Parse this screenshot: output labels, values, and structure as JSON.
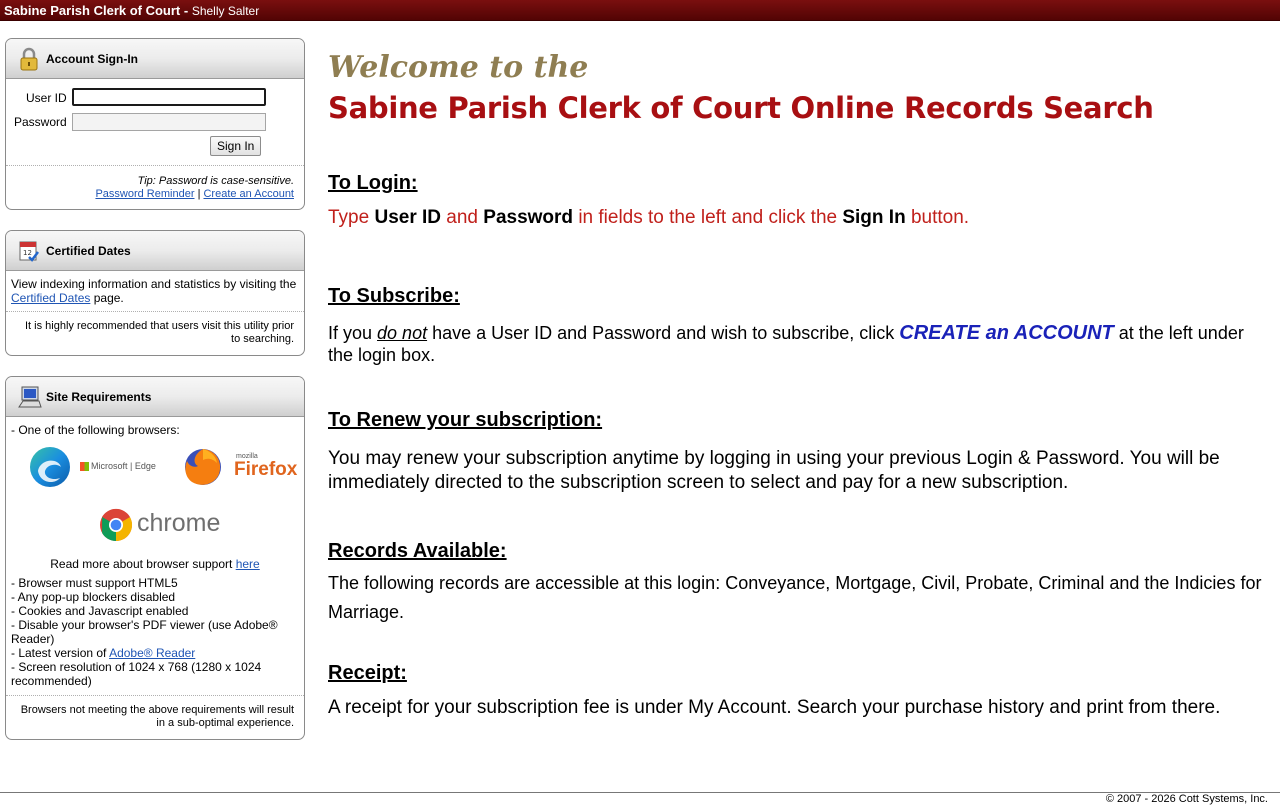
{
  "header": {
    "site": "Sabine Parish Clerk of Court -",
    "user": "Shelly Salter"
  },
  "signin": {
    "title": "Account Sign-In",
    "userid_label": "User ID",
    "password_label": "Password",
    "userid_value": "",
    "password_value": "",
    "signin_button": "Sign In",
    "tip": "Tip: Password is case-sensitive.",
    "reminder_link": "Password Reminder",
    "separator": "|",
    "create_link": "Create an Account"
  },
  "certified": {
    "title": "Certified Dates",
    "text_before": "View indexing information and statistics by visiting the",
    "link": "Certified Dates",
    "text_after": "page.",
    "note": "It is highly recommended that users visit this utility prior to searching."
  },
  "requirements": {
    "title": "Site Requirements",
    "intro": "- One of the following browsers:",
    "browsers": {
      "edge": "Microsoft | Edge",
      "firefox_small": "mozilla",
      "firefox": "Firefox",
      "chrome": "chrome"
    },
    "read_more": "Read more about browser support",
    "here_link": "here",
    "items": [
      "- Browser must support HTML5",
      "- Any pop-up blockers disabled",
      "- Cookies and Javascript enabled",
      "- Disable your browser's PDF viewer (use Adobe® Reader)"
    ],
    "latest_prefix": "- Latest version of",
    "adobe_link": "Adobe® Reader",
    "resolution": "- Screen resolution of 1024 x 768 (1280 x 1024 recommended)",
    "note": "Browsers not meeting the above requirements will result in a sub-optimal experience."
  },
  "main": {
    "welcome": "Welcome to the",
    "title": "Sabine Parish Clerk of Court Online Records Search",
    "login": {
      "heading": "To Login:",
      "p1": "Type ",
      "b1": "User ID",
      "p2": " and ",
      "b2": "Password",
      "p3": " in fields to the left and click the ",
      "b3": "Sign In",
      "p4": " button."
    },
    "subscribe": {
      "heading": "To Subscribe:",
      "p1": "If you ",
      "em": "do not",
      "p2": " have a User ID and Password and wish to subscribe, click ",
      "cta": "CREATE an ACCOUNT",
      "p3": " at the left under the login box."
    },
    "renew": {
      "heading": "To Renew your subscription: ",
      "text": "You may renew your subscription anytime by logging in using your previous Login & Password. You will be immediately directed to the subscription screen to select and pay for a new subscription."
    },
    "records": {
      "heading": "Records Available:",
      "text": "The following records are accessible at this login: Conveyance, Mortgage, Civil, Probate, Criminal and the Indicies for Marriage."
    },
    "receipt": {
      "heading": "Receipt:",
      "text": "A receipt for your subscription fee is under My Account. Search your purchase history and print from there."
    }
  },
  "footer": {
    "copyright": "© 2007 - 2026 Cott Systems, Inc."
  }
}
